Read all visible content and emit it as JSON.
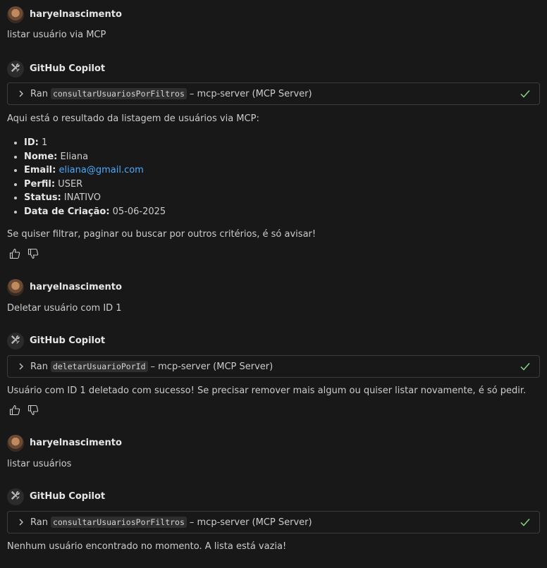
{
  "user_name": "haryelnascimento",
  "bot_name": "GitHub Copilot",
  "ran_label": "Ran",
  "tool_suffix": "– mcp-server (MCP Server)",
  "turn1": {
    "user_msg": "listar usuário via MCP",
    "tool_name": "consultarUsuariosPorFiltros",
    "intro": "Aqui está o resultado da listagem de usuários via MCP:",
    "details": [
      {
        "label": "ID:",
        "value": " 1"
      },
      {
        "label": "Nome:",
        "value": " Eliana"
      },
      {
        "label": "Email:",
        "value": "eliana@gmail.com"
      },
      {
        "label": "Perfil:",
        "value": " USER"
      },
      {
        "label": "Status:",
        "value": " INATIVO"
      },
      {
        "label": "Data de Criação:",
        "value": " 05-06-2025"
      }
    ],
    "outro": "Se quiser filtrar, paginar ou buscar por outros critérios, é só avisar!"
  },
  "turn2": {
    "user_msg": "Deletar usuário com ID 1",
    "tool_name": "deletarUsuarioPorId",
    "reply": "Usuário com ID 1 deletado com sucesso! Se precisar remover mais algum ou quiser listar novamente, é só pedir."
  },
  "turn3": {
    "user_msg": "listar usuários",
    "tool_name": "consultarUsuariosPorFiltros",
    "reply": "Nenhum usuário encontrado no momento. A lista está vazia!"
  },
  "icons": {
    "tool_chevron": "chevron-right-icon",
    "tool_done": "check-icon",
    "bot": "tools-icon",
    "helpful": "thumbs-up-icon",
    "unhelpful": "thumbs-down-icon"
  },
  "colors": {
    "background": "#181818",
    "link": "#4daafc",
    "check": "#89d185"
  }
}
